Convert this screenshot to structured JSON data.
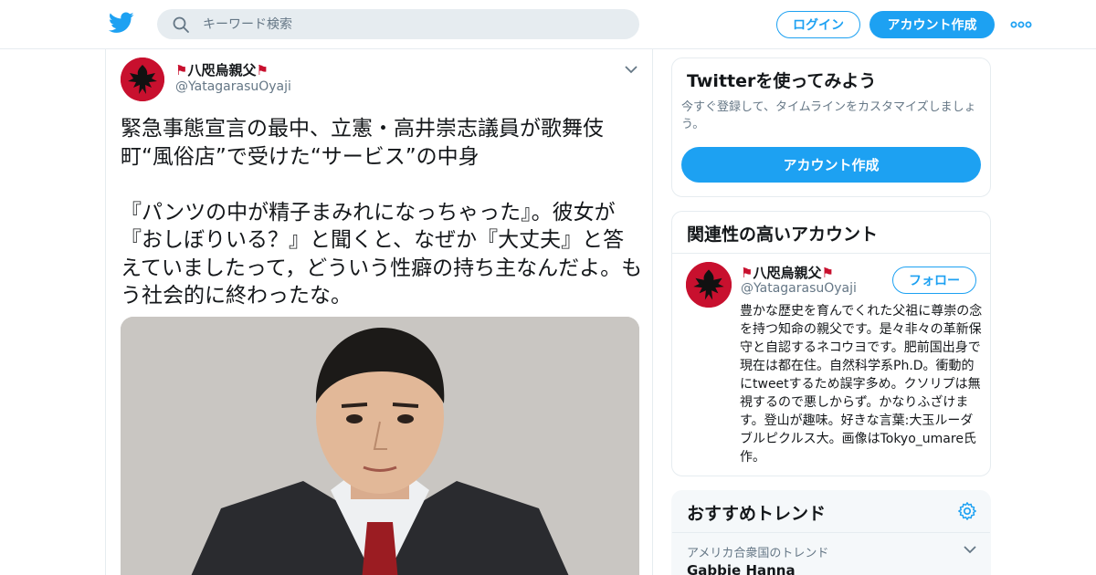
{
  "header": {
    "search_placeholder": "キーワード検索",
    "login_label": "ログイン",
    "signup_label": "アカウント作成"
  },
  "colors": {
    "brand_blue": "#1da1f2",
    "text_primary": "#14171a",
    "text_secondary": "#657786",
    "border": "#e6ecf0"
  },
  "tweet": {
    "author_name": "八咫烏親父",
    "author_handle": "@YatagarasuOyaji",
    "text": "緊急事態宣言の最中、立憲・高井崇志議員が歌舞伎町“風俗店”で受けた“サービス”の中身\n\n『パンツの中が精子まみれになっちゃった』。彼女が『おしぼりいる？』と聞くと、なぜか『大丈夫』と答えていましたって，どういう性癖の持ち主なんだよ。もう社会的に終わったな。"
  },
  "sidebar": {
    "signup_card": {
      "title": "Twitterを使ってみよう",
      "description": "今すぐ登録して、タイムラインをカスタマイズしましょう。",
      "button_label": "アカウント作成"
    },
    "related_card": {
      "title": "関連性の高いアカウント",
      "account": {
        "name": "八咫烏親父",
        "handle": "@YatagarasuOyaji",
        "follow_label": "フォロー",
        "bio": "豊かな歴史を育んでくれた父祖に尊崇の念を持つ知命の親父です。是々非々の革新保守と自認するネコウヨです。肥前国出身で現在は都在住。自然科学系Ph.D。衝動的にtweetするため誤字多め。クソリプは無視するので悪しからず。かなりふざけます。登山が趣味。好きな言葉:大玉ルーダブルピクルス大。画像はTokyo_umare氏作。"
      }
    },
    "trends_card": {
      "title": "おすすめトレンド",
      "trends": [
        {
          "context": "アメリカ合衆国のトレンド",
          "name": "Gabbie Hanna"
        }
      ]
    }
  }
}
